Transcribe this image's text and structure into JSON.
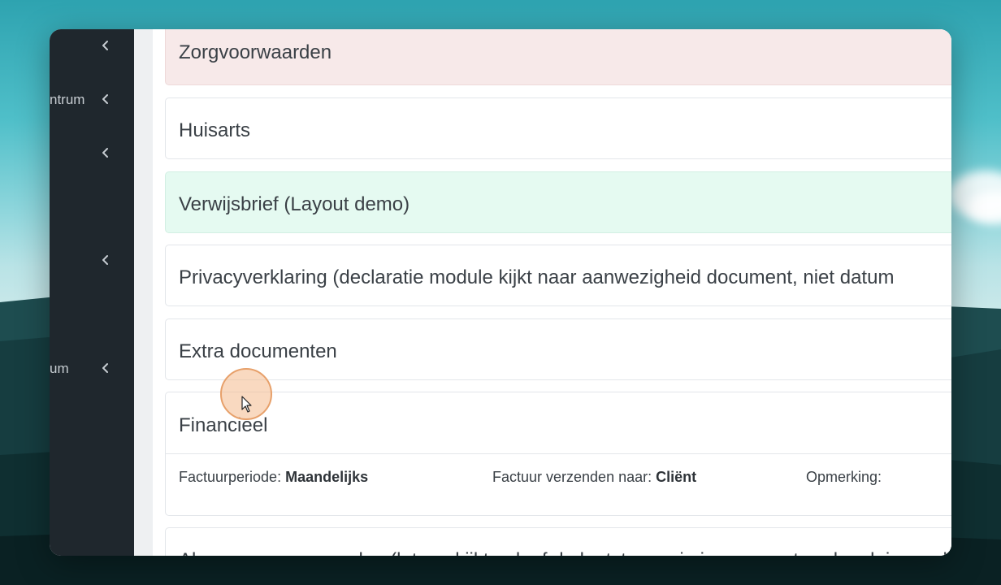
{
  "sidebar": {
    "items": [
      {
        "label": "",
        "icon": "chevron-left-icon"
      },
      {
        "label": "ntrum",
        "icon": "chevron-left-icon"
      },
      {
        "label": "",
        "icon": "chevron-left-icon"
      },
      {
        "label": "",
        "icon": "chevron-left-icon"
      },
      {
        "label": "um",
        "icon": "chevron-left-icon"
      }
    ]
  },
  "cards": [
    {
      "title": "Zorgvoorwaarden",
      "status": "pink"
    },
    {
      "title": "Huisarts",
      "status": "neutral"
    },
    {
      "title": "Verwijsbrief (Layout demo)",
      "status": "mint"
    },
    {
      "title": "Privacyverklaring (declaratie module kijkt naar aanwezigheid document, niet datum",
      "status": "neutral"
    },
    {
      "title": "Extra documenten",
      "status": "neutral"
    },
    {
      "title": "Financieel",
      "status": "neutral"
    },
    {
      "title": "Algemene voorwaarden (let op: kijkt ook of de laatste versie is geaccepteerd, ook in combinatie met datum",
      "status": "neutral"
    }
  ],
  "financieel": {
    "period_label": "Factuurperiode:",
    "period_value": "Maandelijks",
    "send_label": "Factuur verzenden naar:",
    "send_value": "Cliënt",
    "remark_label": "Opmerking:"
  },
  "colors": {
    "sidebar_bg": "#1f272d",
    "pink_card": "#f7e9e9",
    "mint_card": "#e5faf1",
    "cursor_highlight": "#e7a06a"
  }
}
